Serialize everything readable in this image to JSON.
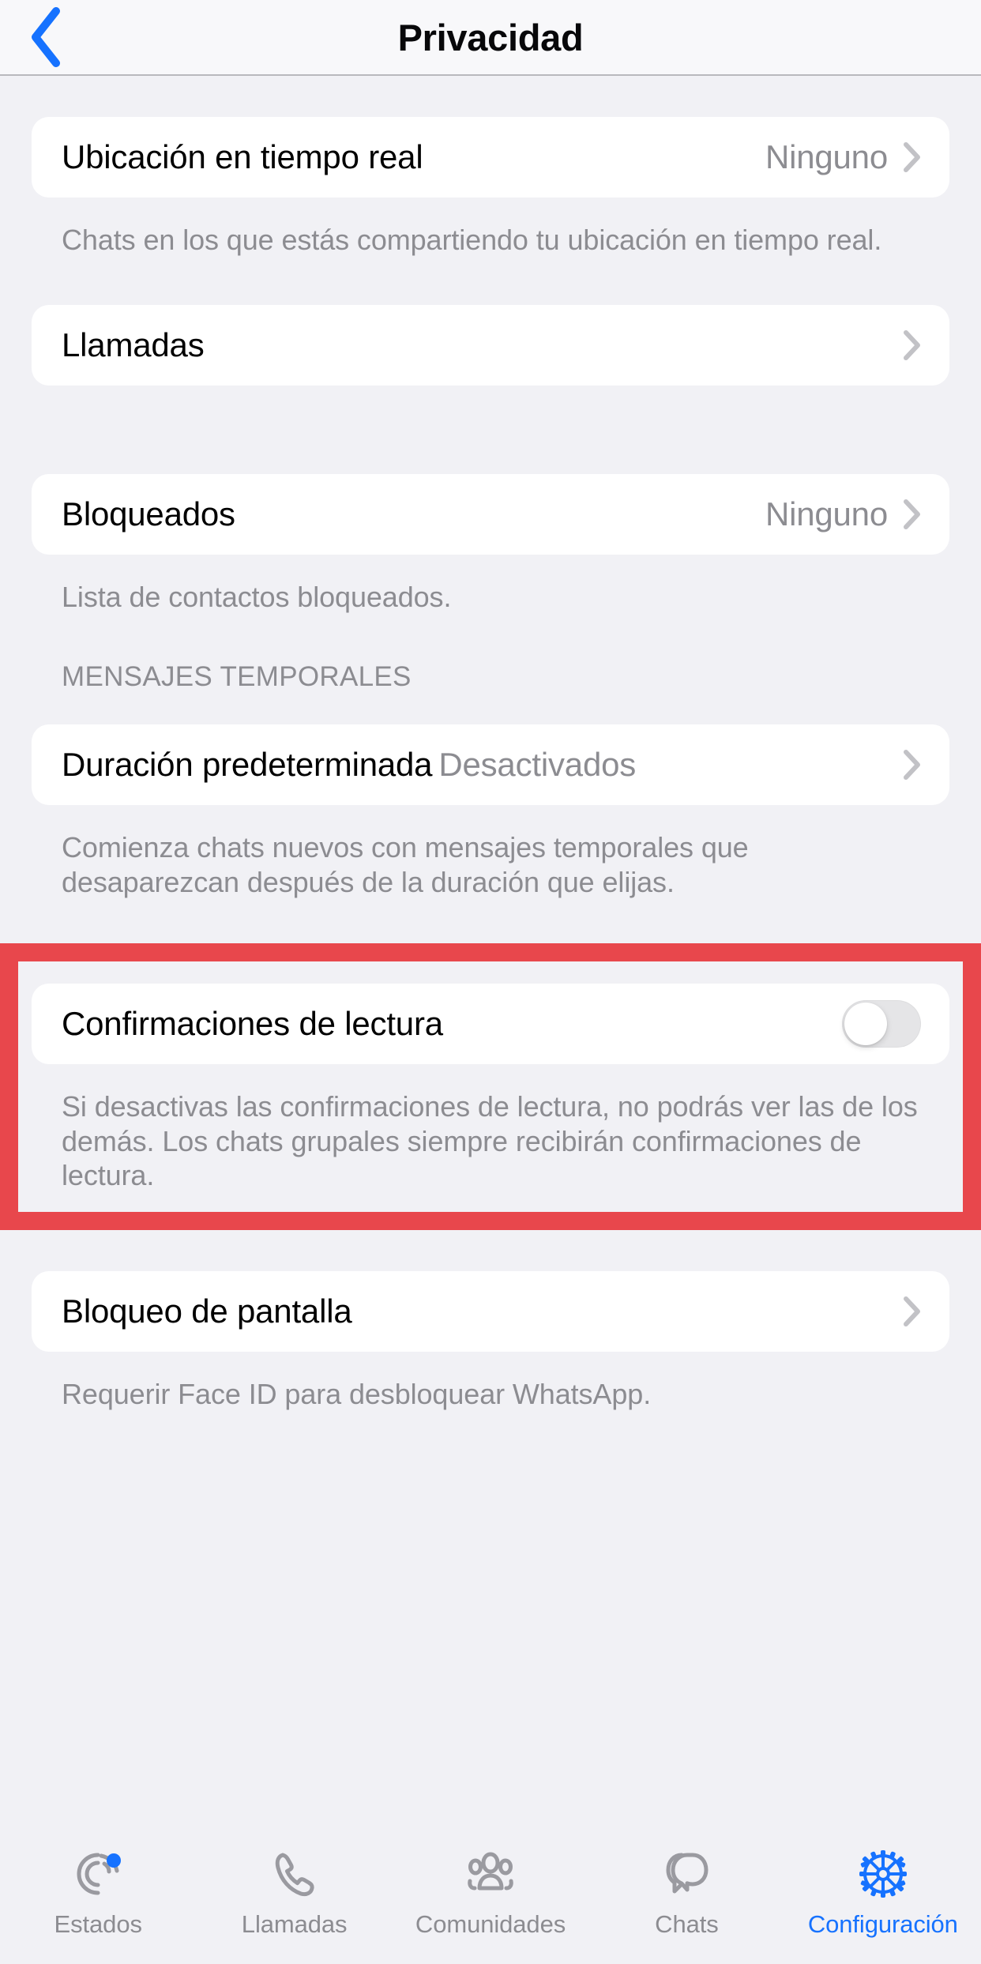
{
  "header": {
    "back_icon": "chevron-left-icon",
    "title": "Privacidad",
    "accent": "#1672ff"
  },
  "sections": [
    {
      "row": {
        "label": "Ubicación en tiempo real",
        "value": "Ninguno",
        "accessory": "chevron-right-icon"
      },
      "description": "Chats en los que estás compartiendo tu ubicación en tiempo real."
    },
    {
      "row": {
        "label": "Llamadas",
        "value": "",
        "accessory": "chevron-right-icon"
      },
      "description": ""
    },
    {
      "row": {
        "label": "Bloqueados",
        "value": "Ninguno",
        "accessory": "chevron-right-icon"
      },
      "description": "Lista de contactos bloqueados."
    },
    {
      "header": "MENSAJES TEMPORALES",
      "row": {
        "label": "Duración predeterminada",
        "value": "Desactivados",
        "accessory": "chevron-right-icon"
      },
      "description": "Comienza chats nuevos con mensajes temporales que desaparezcan después de la duración que elijas."
    },
    {
      "highlighted": true,
      "highlight_color": "#e8474c",
      "row": {
        "label": "Confirmaciones de lectura",
        "accessory": "toggle-switch",
        "toggle_state": "off"
      },
      "description": "Si desactivas las confirmaciones de lectura, no podrás ver las de los demás. Los chats grupales siempre recibirán confirmaciones de lectura."
    },
    {
      "row": {
        "label": "Bloqueo de pantalla",
        "value": "",
        "accessory": "chevron-right-icon"
      },
      "description": "Requerir Face ID para desbloquear WhatsApp."
    }
  ],
  "tabbar": {
    "active_color": "#1672ff",
    "inactive_color": "#8c8c91",
    "items": [
      {
        "label": "Estados",
        "icon": "status-rings-icon",
        "active": false,
        "badge": true
      },
      {
        "label": "Llamadas",
        "icon": "phone-icon",
        "active": false,
        "badge": false
      },
      {
        "label": "Comunidades",
        "icon": "people-group-icon",
        "active": false,
        "badge": false
      },
      {
        "label": "Chats",
        "icon": "chat-bubbles-icon",
        "active": false,
        "badge": false
      },
      {
        "label": "Configuración",
        "icon": "gear-icon",
        "active": true,
        "badge": false
      }
    ]
  }
}
